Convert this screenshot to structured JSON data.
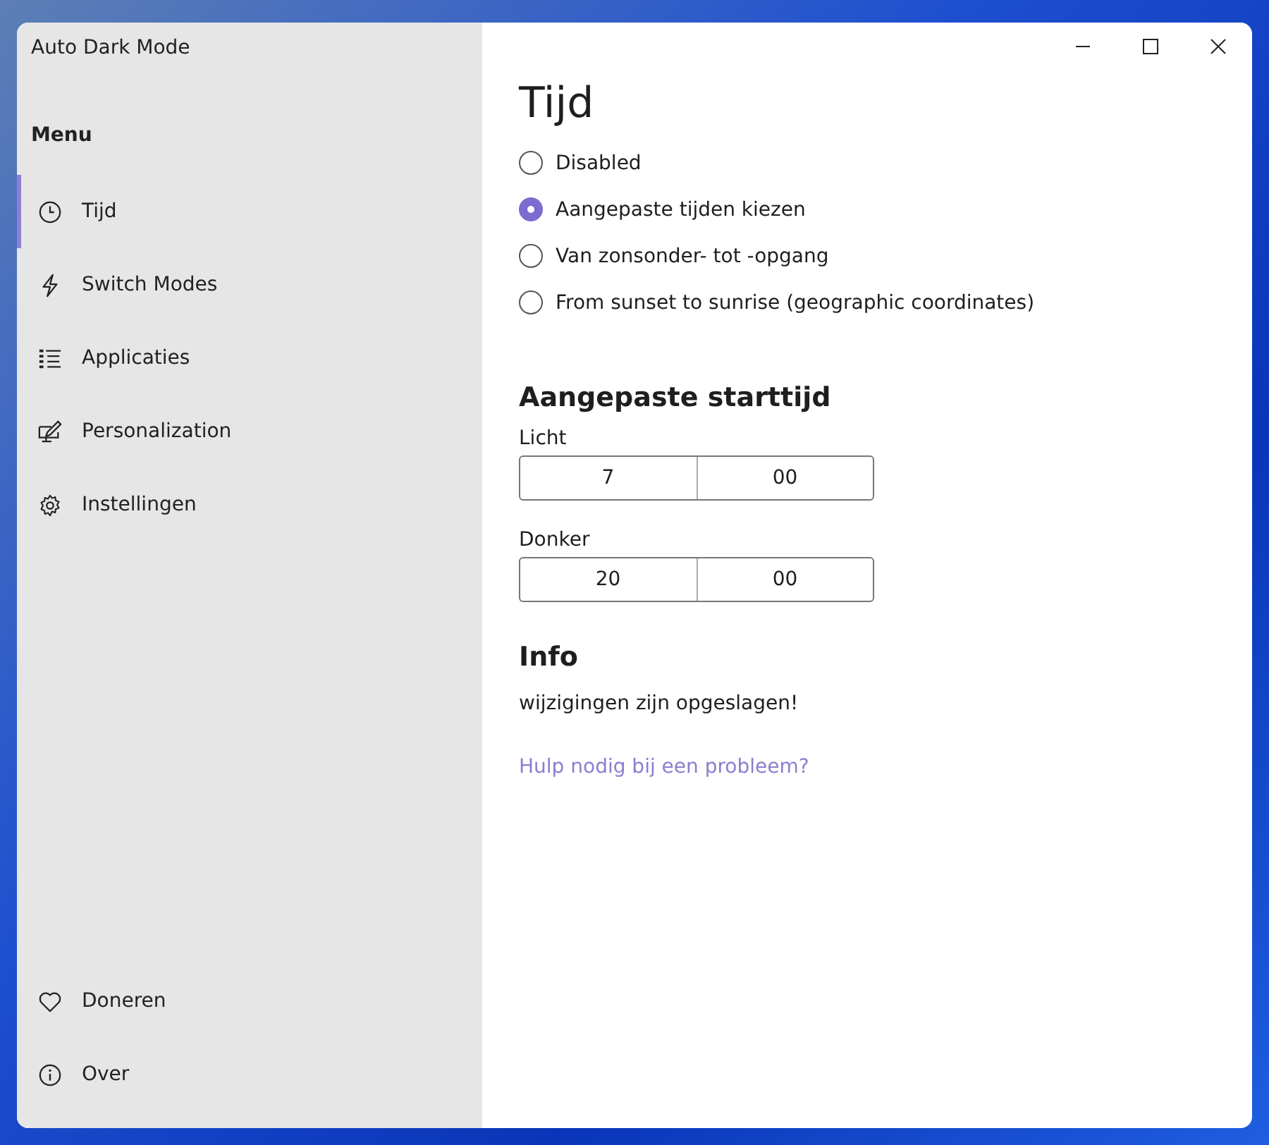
{
  "window": {
    "title": "Auto Dark Mode"
  },
  "sidebar": {
    "heading": "Menu",
    "items": [
      {
        "label": "Tijd",
        "selected": true
      },
      {
        "label": "Switch Modes",
        "selected": false
      },
      {
        "label": "Applicaties",
        "selected": false
      },
      {
        "label": "Personalization",
        "selected": false
      },
      {
        "label": "Instellingen",
        "selected": false
      }
    ],
    "footer_items": [
      {
        "label": "Doneren",
        "selected": false
      },
      {
        "label": "Over",
        "selected": false
      }
    ]
  },
  "page": {
    "title": "Tijd",
    "options": [
      {
        "label": "Disabled",
        "selected": false
      },
      {
        "label": "Aangepaste tijden kiezen",
        "selected": true
      },
      {
        "label": "Van zonsonder- tot -opgang",
        "selected": false
      },
      {
        "label": "From sunset to sunrise (geographic coordinates)",
        "selected": false
      }
    ],
    "start_section": {
      "heading": "Aangepaste starttijd",
      "times": [
        {
          "label": "Licht",
          "hour": "7",
          "minute": "00"
        },
        {
          "label": "Donker",
          "hour": "20",
          "minute": "00"
        }
      ]
    },
    "info": {
      "heading": "Info",
      "message": "wijzigingen zijn opgeslagen!",
      "link": "Hulp nodig bij een probleem?"
    }
  }
}
